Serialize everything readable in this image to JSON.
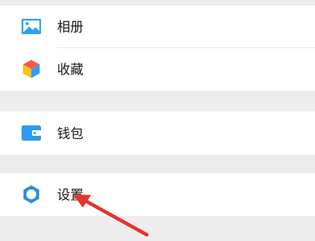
{
  "menu": {
    "album": {
      "label": "相册",
      "icon": "album-icon"
    },
    "favorites": {
      "label": "收藏",
      "icon": "favorites-cube-icon"
    },
    "wallet": {
      "label": "钱包",
      "icon": "wallet-icon"
    },
    "settings": {
      "label": "设置",
      "icon": "settings-gear-icon"
    }
  },
  "colors": {
    "background": "#ededed",
    "row": "#ffffff",
    "album_icon": "#2ba1f3",
    "wallet_icon": "#2f9bef",
    "settings_icon": "#2b8fe0",
    "arrow": "#e8322f"
  }
}
